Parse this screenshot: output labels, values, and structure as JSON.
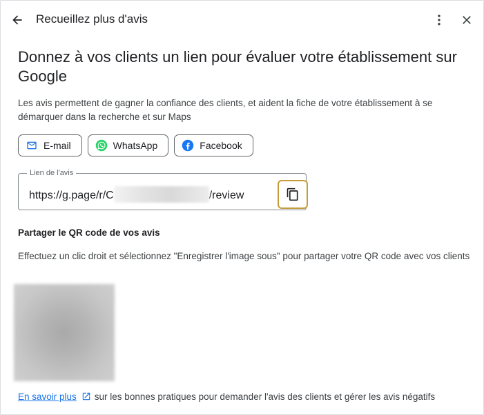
{
  "header": {
    "title": "Recueillez plus d'avis"
  },
  "main": {
    "title": "Donnez à vos clients un lien pour évaluer votre établissement sur Google",
    "description": "Les avis permettent de gagner la confiance des clients, et aident la fiche de votre établissement à se démarquer dans la recherche et sur Maps"
  },
  "share": {
    "email_label": "E-mail",
    "whatsapp_label": "WhatsApp",
    "facebook_label": "Facebook"
  },
  "review_link": {
    "label": "Lien de l'avis",
    "prefix": "https://g.page/r/C",
    "suffix": "/review"
  },
  "qr": {
    "heading": "Partager le QR code de vos avis",
    "description": "Effectuez un clic droit et sélectionnez \"Enregistrer l'image sous\" pour partager votre QR code avec vos clients"
  },
  "footer": {
    "link_text": "En savoir plus",
    "text": "sur les bonnes pratiques pour demander l'avis des clients et gérer les avis négatifs"
  },
  "colors": {
    "accent_link": "#1a73e8",
    "copy_highlight": "#c69b3a",
    "whatsapp": "#25d366",
    "facebook": "#1877f2",
    "email": "#1a73e8"
  },
  "icons": {
    "back": "arrow-left-icon",
    "more": "more-vert-icon",
    "close": "close-icon",
    "email": "mail-icon",
    "whatsapp": "whatsapp-icon",
    "facebook": "facebook-icon",
    "copy": "copy-icon",
    "external": "open-in-new-icon"
  }
}
